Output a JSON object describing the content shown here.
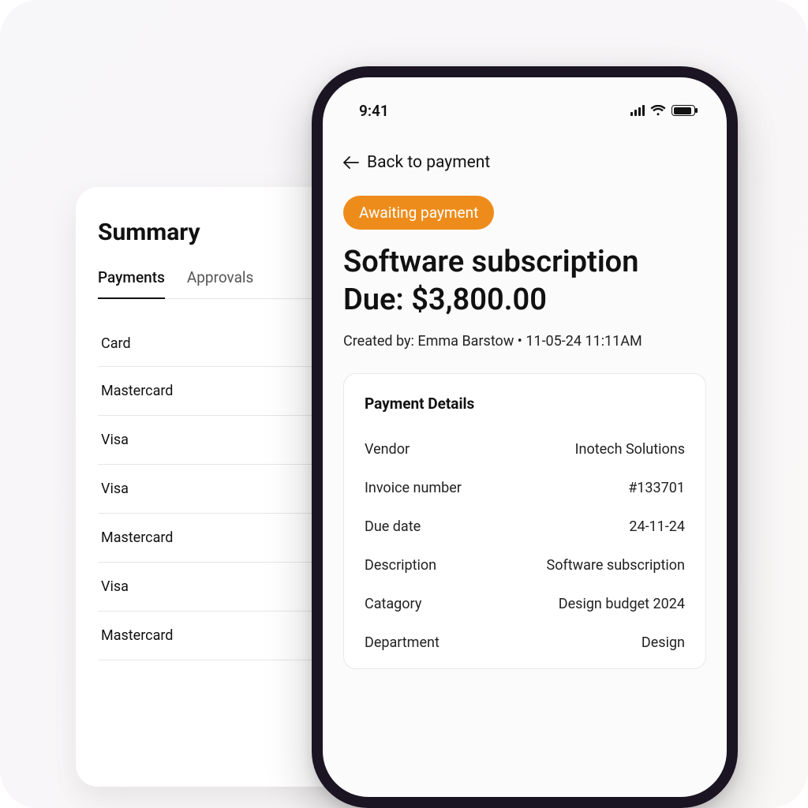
{
  "summary": {
    "title": "Summary",
    "tabs": {
      "payments": "Payments",
      "approvals": "Approvals"
    },
    "column_header": "Card",
    "rows": [
      "Mastercard",
      "Visa",
      "Visa",
      "Mastercard",
      "Visa",
      "Mastercard"
    ]
  },
  "phone": {
    "status_time": "9:41",
    "back_label": "Back to payment",
    "badge": "Awaiting payment",
    "title": "Software subscription",
    "due_prefix": "Due: ",
    "due_amount": "$3,800.00",
    "meta": "Created by: Emma Barstow • 11-05-24 11:11AM",
    "details": {
      "heading": "Payment Details",
      "rows": [
        {
          "label": "Vendor",
          "value": "Inotech Solutions"
        },
        {
          "label": "Invoice number",
          "value": "#133701"
        },
        {
          "label": "Due date",
          "value": "24-11-24"
        },
        {
          "label": "Description",
          "value": "Software subscription"
        },
        {
          "label": "Catagory",
          "value": "Design budget 2024"
        },
        {
          "label": "Department",
          "value": "Design"
        }
      ]
    }
  }
}
